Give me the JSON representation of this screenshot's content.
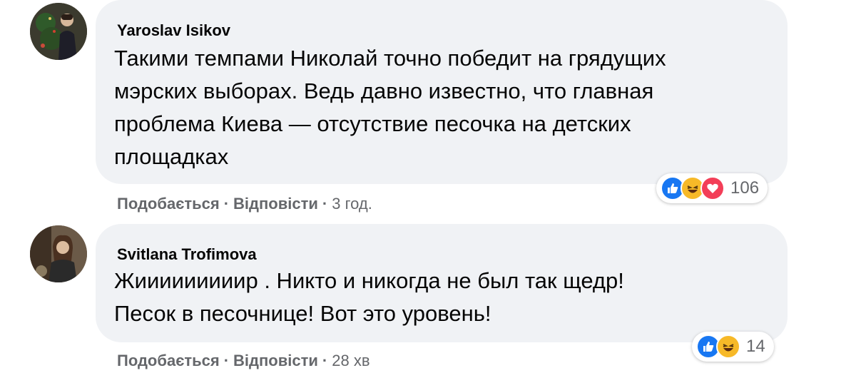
{
  "comments": [
    {
      "author": "Yaroslav Isikov",
      "text_lines": [
        "Такими темпами Николай точно победит на грядущих",
        "мэрских выборах. Ведь давно известно, что главная",
        "проблема Киева — отсутствие песочка на детских",
        "площадках"
      ],
      "like_label": "Подобається",
      "reply_label": "Відповісти",
      "time": "3 год.",
      "reaction_count": "106",
      "reactions": [
        "like-icon",
        "haha-icon",
        "love-icon"
      ]
    },
    {
      "author": "Svitlana Trofimova",
      "text_lines": [
        "Жииииииииир . Никто и никогда не был так щедр!",
        "Песок в песочнице! Вот это уровень!"
      ],
      "like_label": "Подобається",
      "reply_label": "Відповісти",
      "time": "28 хв",
      "reaction_count": "14",
      "reactions": [
        "like-icon",
        "haha-icon"
      ]
    }
  ],
  "colors": {
    "bubble": "#f0f2f5",
    "meta_text": "#65676b",
    "like": "#1877f2",
    "haha": "#f7b928",
    "love": "#f33e58"
  }
}
